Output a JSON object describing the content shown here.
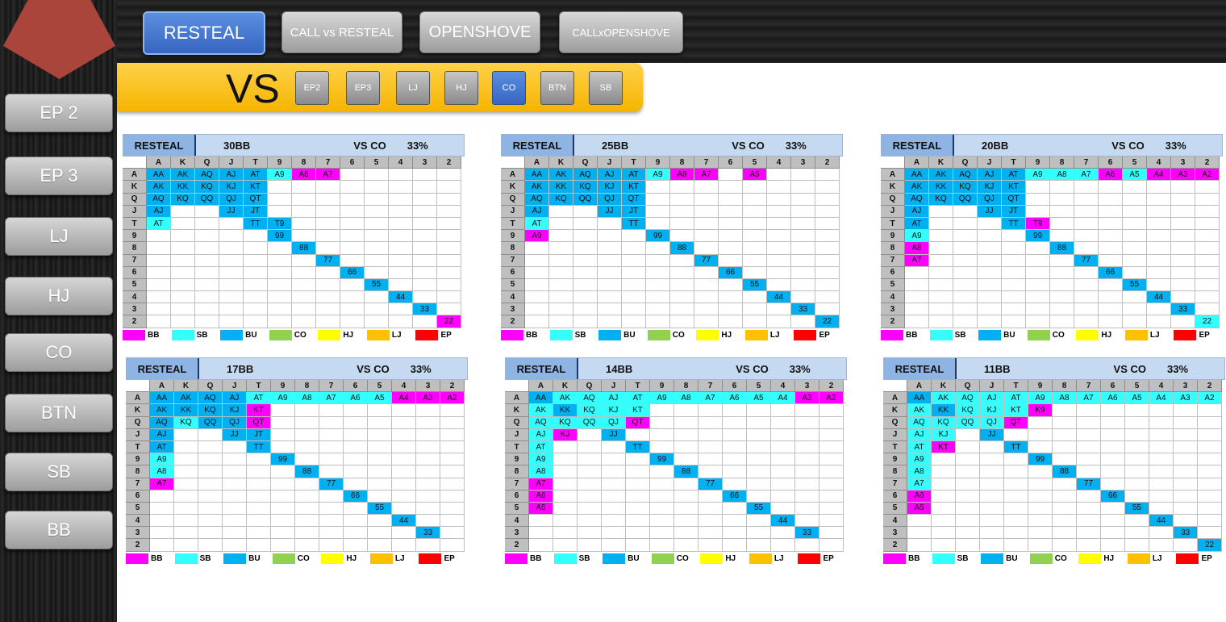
{
  "sidebar": {
    "items": [
      "EP 2",
      "EP 3",
      "LJ",
      "HJ",
      "CO",
      "BTN",
      "SB",
      "BB"
    ]
  },
  "topbar": {
    "buttons": [
      {
        "label": "RESTEAL",
        "active": true
      },
      {
        "label": "CALL vs RESTEAL",
        "active": false
      },
      {
        "label": "OPENSHOVE",
        "active": false
      },
      {
        "label": "CALLxOPENSHOVE",
        "active": false
      }
    ]
  },
  "vs_bar": {
    "label": "VS",
    "positions": [
      {
        "label": "EP2",
        "active": false
      },
      {
        "label": "EP3",
        "active": false
      },
      {
        "label": "LJ",
        "active": false
      },
      {
        "label": "HJ",
        "active": false
      },
      {
        "label": "CO",
        "active": true
      },
      {
        "label": "BTN",
        "active": false
      },
      {
        "label": "SB",
        "active": false
      }
    ]
  },
  "colors": {
    "BB": "#ff00ff",
    "SB": "#33ffff",
    "BU": "#00b0f0",
    "CO": "#92d050",
    "HJ": "#ffff00",
    "LJ": "#ffc000",
    "EP": "#ff0000"
  },
  "grid_ranks": [
    "A",
    "K",
    "Q",
    "J",
    "T",
    "9",
    "8",
    "7",
    "6",
    "5",
    "4",
    "3",
    "2"
  ],
  "legend": [
    {
      "key": "BB",
      "label": "BB"
    },
    {
      "key": "SB",
      "label": "SB"
    },
    {
      "key": "BU",
      "label": "BU"
    },
    {
      "key": "CO",
      "label": "CO"
    },
    {
      "key": "HJ",
      "label": "HJ"
    },
    {
      "key": "LJ",
      "label": "LJ"
    },
    {
      "key": "EP",
      "label": "EP"
    }
  ],
  "panels": [
    {
      "title": "RESTEAL",
      "stack": "30BB",
      "vs": "VS CO",
      "pct": "33%",
      "cells": {
        "AA": "BU",
        "AKs": "BU",
        "AQs": "BU",
        "AJs": "BU",
        "ATs": "BU",
        "A9s": "SB",
        "A8s": "BB",
        "A7s": "BB",
        "AKo": "BU",
        "KK": "BU",
        "KQs": "BU",
        "KJs": "BU",
        "KTs": "BU",
        "AQo": "BU",
        "KQo": "BU",
        "QQ": "BU",
        "QJs": "BU",
        "QTs": "BU",
        "AJo": "BU",
        "JJ": "BU",
        "JTs": "BU",
        "ATo": "SB",
        "TT": "BU",
        "T9s": "BU",
        "99": "BU",
        "88": "BU",
        "77": "BU",
        "66": "BU",
        "55": "BU",
        "44": "BU",
        "33": "BU",
        "22": "BB"
      }
    },
    {
      "title": "RESTEAL",
      "stack": "25BB",
      "vs": "VS CO",
      "pct": "33%",
      "cells": {
        "AA": "BU",
        "AKs": "BU",
        "AQs": "BU",
        "AJs": "BU",
        "ATs": "BU",
        "A9s": "SB",
        "A8s": "BB",
        "A7s": "BB",
        "A5s": "BB",
        "AKo": "BU",
        "KK": "BU",
        "KQs": "BU",
        "KJs": "BU",
        "KTs": "BU",
        "AQo": "BU",
        "KQo": "BU",
        "QQ": "BU",
        "QJs": "BU",
        "QTs": "BU",
        "AJo": "BU",
        "JJ": "BU",
        "JTs": "BU",
        "ATo": "SB",
        "TT": "BU",
        "A9o": "BB",
        "99": "BU",
        "88": "BU",
        "77": "BU",
        "66": "BU",
        "55": "BU",
        "44": "BU",
        "33": "BU",
        "22": "BU"
      }
    },
    {
      "title": "RESTEAL",
      "stack": "20BB",
      "vs": "VS CO",
      "pct": "33%",
      "cells": {
        "AA": "BU",
        "AKs": "BU",
        "AQs": "BU",
        "AJs": "BU",
        "ATs": "BU",
        "A9s": "SB",
        "A8s": "SB",
        "A7s": "SB",
        "A6s": "BB",
        "A5s": "SB",
        "A4s": "BB",
        "A3s": "BB",
        "A2s": "BB",
        "AKo": "BU",
        "KK": "BU",
        "KQs": "BU",
        "KJs": "BU",
        "KTs": "BU",
        "AQo": "BU",
        "KQo": "BU",
        "QQ": "BU",
        "QJs": "BU",
        "QTs": "BU",
        "AJo": "BU",
        "JJ": "BU",
        "JTs": "BU",
        "ATo": "BU",
        "TT": "BU",
        "T9s": "BB",
        "A9o": "SB",
        "99": "BU",
        "A8o": "BB",
        "88": "BU",
        "A7o": "BB",
        "77": "BU",
        "66": "BU",
        "55": "BU",
        "44": "BU",
        "33": "BU",
        "22": "SB"
      }
    },
    {
      "title": "RESTEAL",
      "stack": "17BB",
      "vs": "VS CO",
      "pct": "33%",
      "cells": {
        "AA": "BU",
        "AKs": "BU",
        "AQs": "BU",
        "AJs": "BU",
        "ATs": "SB",
        "A9s": "SB",
        "A8s": "SB",
        "A7s": "SB",
        "A6s": "SB",
        "A5s": "SB",
        "A4s": "BB",
        "A3s": "BB",
        "A2s": "BB",
        "AKo": "BU",
        "KK": "BU",
        "KQs": "BU",
        "KJs": "BU",
        "KTs": "BB",
        "AQo": "BU",
        "KQo": "SB",
        "QQ": "BU",
        "QJs": "BU",
        "QTs": "BB",
        "AJo": "BU",
        "JJ": "BU",
        "JTs": "BU",
        "ATo": "BU",
        "TT": "BU",
        "A9o": "SB",
        "99": "BU",
        "A8o": "SB",
        "88": "BU",
        "A7o": "BB",
        "77": "BU",
        "66": "BU",
        "55": "BU",
        "44": "BU",
        "33": "BU"
      }
    },
    {
      "title": "RESTEAL",
      "stack": "14BB",
      "vs": "VS CO",
      "pct": "33%",
      "cells": {
        "AA": "BU",
        "AKs": "SB",
        "AQs": "SB",
        "AJs": "SB",
        "ATs": "SB",
        "A9s": "SB",
        "A8s": "SB",
        "A7s": "SB",
        "A6s": "SB",
        "A5s": "SB",
        "A4s": "SB",
        "A3s": "BB",
        "A2s": "BB",
        "AKo": "SB",
        "KK": "BU",
        "KQs": "SB",
        "KJs": "SB",
        "KTs": "SB",
        "AQo": "SB",
        "KQo": "SB",
        "QQ": "SB",
        "QJs": "SB",
        "QTs": "BB",
        "AJo": "SB",
        "KJo": "BB",
        "JJ": "BU",
        "ATo": "SB",
        "TT": "BU",
        "A9o": "SB",
        "99": "BU",
        "A8o": "SB",
        "88": "BU",
        "A7o": "BB",
        "77": "BU",
        "A6o": "BB",
        "66": "BU",
        "A5o": "BB",
        "55": "BU",
        "44": "BU",
        "33": "BU"
      }
    },
    {
      "title": "RESTEAL",
      "stack": "11BB",
      "vs": "VS CO",
      "pct": "33%",
      "cells": {
        "AA": "BU",
        "AKs": "SB",
        "AQs": "SB",
        "AJs": "SB",
        "ATs": "SB",
        "A9s": "SB",
        "A8s": "SB",
        "A7s": "SB",
        "A6s": "SB",
        "A5s": "SB",
        "A4s": "SB",
        "A3s": "SB",
        "A2s": "SB",
        "AKo": "SB",
        "KK": "BU",
        "KQs": "SB",
        "KJs": "SB",
        "KTs": "SB",
        "K9s": "BB",
        "AQo": "SB",
        "KQo": "SB",
        "QQ": "SB",
        "QJs": "SB",
        "QTs": "BB",
        "AJo": "SB",
        "KJo": "SB",
        "JJ": "BU",
        "ATo": "SB",
        "KTo": "BB",
        "TT": "BU",
        "A9o": "SB",
        "99": "BU",
        "A8o": "SB",
        "88": "BU",
        "A7o": "SB",
        "77": "BU",
        "A6o": "BB",
        "66": "BU",
        "A5o": "BB",
        "55": "BU",
        "44": "BU",
        "33": "BU",
        "22": "BU"
      }
    }
  ]
}
